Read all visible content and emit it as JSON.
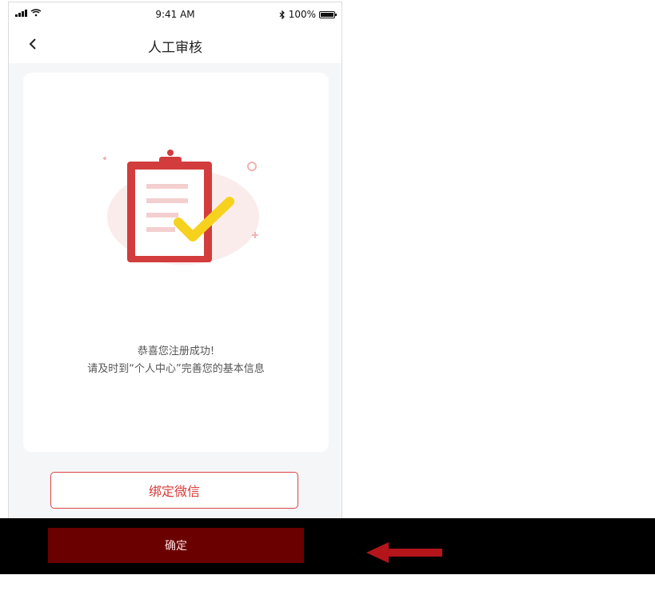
{
  "status_bar": {
    "time": "9:41 AM",
    "battery": "100%"
  },
  "nav": {
    "title": "人工审核"
  },
  "message": {
    "line1": "恭喜您注册成功!",
    "line2": "请及时到“个人中心”完善您的基本信息"
  },
  "buttons": {
    "bind_wechat": "绑定微信",
    "confirm": "确定"
  },
  "icons": {
    "back": "back-icon",
    "illustration": "clipboard-check-icon"
  },
  "colors": {
    "accent": "#d83a3a",
    "primary_button": "#c9262b",
    "check": "#f6d21e"
  }
}
